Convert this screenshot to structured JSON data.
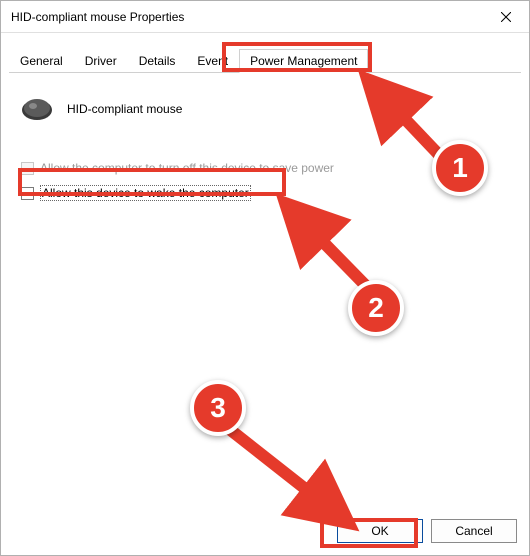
{
  "title": "HID-compliant mouse Properties",
  "tabs": [
    "General",
    "Driver",
    "Details",
    "Event",
    "Power Management"
  ],
  "active_tab": "Power Management",
  "device_name": "HID-compliant mouse",
  "checkbox1_label": "Allow the computer to turn off this device to save power",
  "checkbox2_label": "Allow this device to wake the computer",
  "buttons": {
    "ok": "OK",
    "cancel": "Cancel"
  },
  "annotations": {
    "b1": "1",
    "b2": "2",
    "b3": "3"
  }
}
